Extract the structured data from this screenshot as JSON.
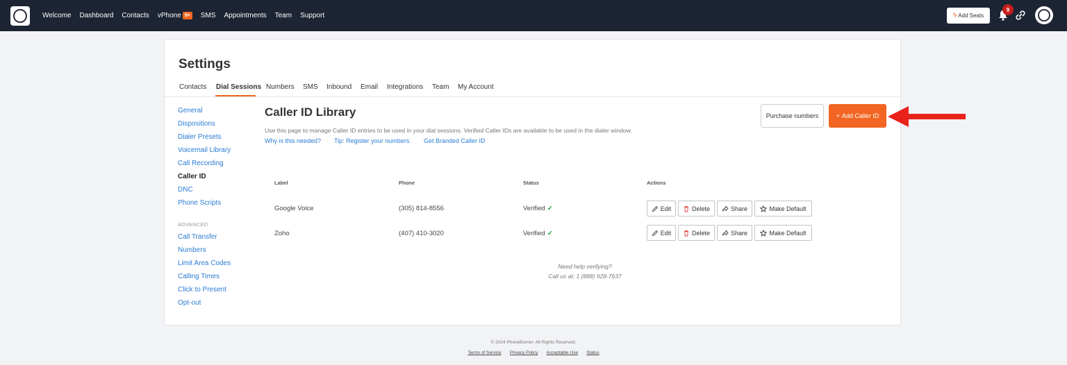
{
  "topnav": {
    "items": [
      "Welcome",
      "Dashboard",
      "Contacts",
      "vPhone",
      "SMS",
      "Appointments",
      "Team",
      "Support"
    ],
    "vphone_badge": "9+",
    "add_seats_label": "Add Seats",
    "notification_count": "9"
  },
  "page": {
    "title": "Settings",
    "tabs": [
      "Contacts",
      "Dial Sessions",
      "Numbers",
      "SMS",
      "Inbound",
      "Email",
      "Integrations",
      "Team",
      "My Account"
    ],
    "active_tab": "Dial Sessions"
  },
  "sidebar": {
    "items": [
      "General",
      "Dispositions",
      "Dialer Presets",
      "Voicemail Library",
      "Call Recording",
      "Caller ID",
      "DNC",
      "Phone Scripts"
    ],
    "active_item": "Caller ID",
    "advanced_heading": "ADVANCED",
    "advanced_items": [
      "Call Transfer",
      "Numbers",
      "Limit Area Codes",
      "Calling Times",
      "Click to Present",
      "Opt-out"
    ]
  },
  "main": {
    "heading": "Caller ID Library",
    "description": "Use this page to manage Caller ID entries to be used in your dial sessions. Verified Caller IDs are available to be used in the dialer window.",
    "help_links": [
      "Why is this needed?",
      "Tip: Register your numbers",
      "Get Branded Caller ID"
    ],
    "purchase_button": "Purchase numbers",
    "add_button": "Add Caller ID",
    "table": {
      "headers": [
        "Label",
        "Phone",
        "Status",
        "Actions"
      ],
      "rows": [
        {
          "label": "Google Voice",
          "phone": "(305) 814-8556",
          "status": "Verified"
        },
        {
          "label": "Zoho",
          "phone": "(407) 410-3020",
          "status": "Verified"
        }
      ],
      "actions": [
        "Edit",
        "Delete",
        "Share",
        "Make Default"
      ]
    },
    "help_line1": "Need help verifying?",
    "help_line2": "Call us at: 1 (888) 928-7637"
  },
  "footer": {
    "copyright": "© 2024 PhoneBurner. All Rights Reserved.",
    "links": [
      "Terms of Service",
      "Privacy Policy",
      "Acceptable Use",
      "Status"
    ]
  },
  "colors": {
    "accent": "#f26522",
    "navbar": "#1d2433",
    "link": "#2a7bd4",
    "verified": "#1a9c3a",
    "arrow": "#e8231b"
  }
}
